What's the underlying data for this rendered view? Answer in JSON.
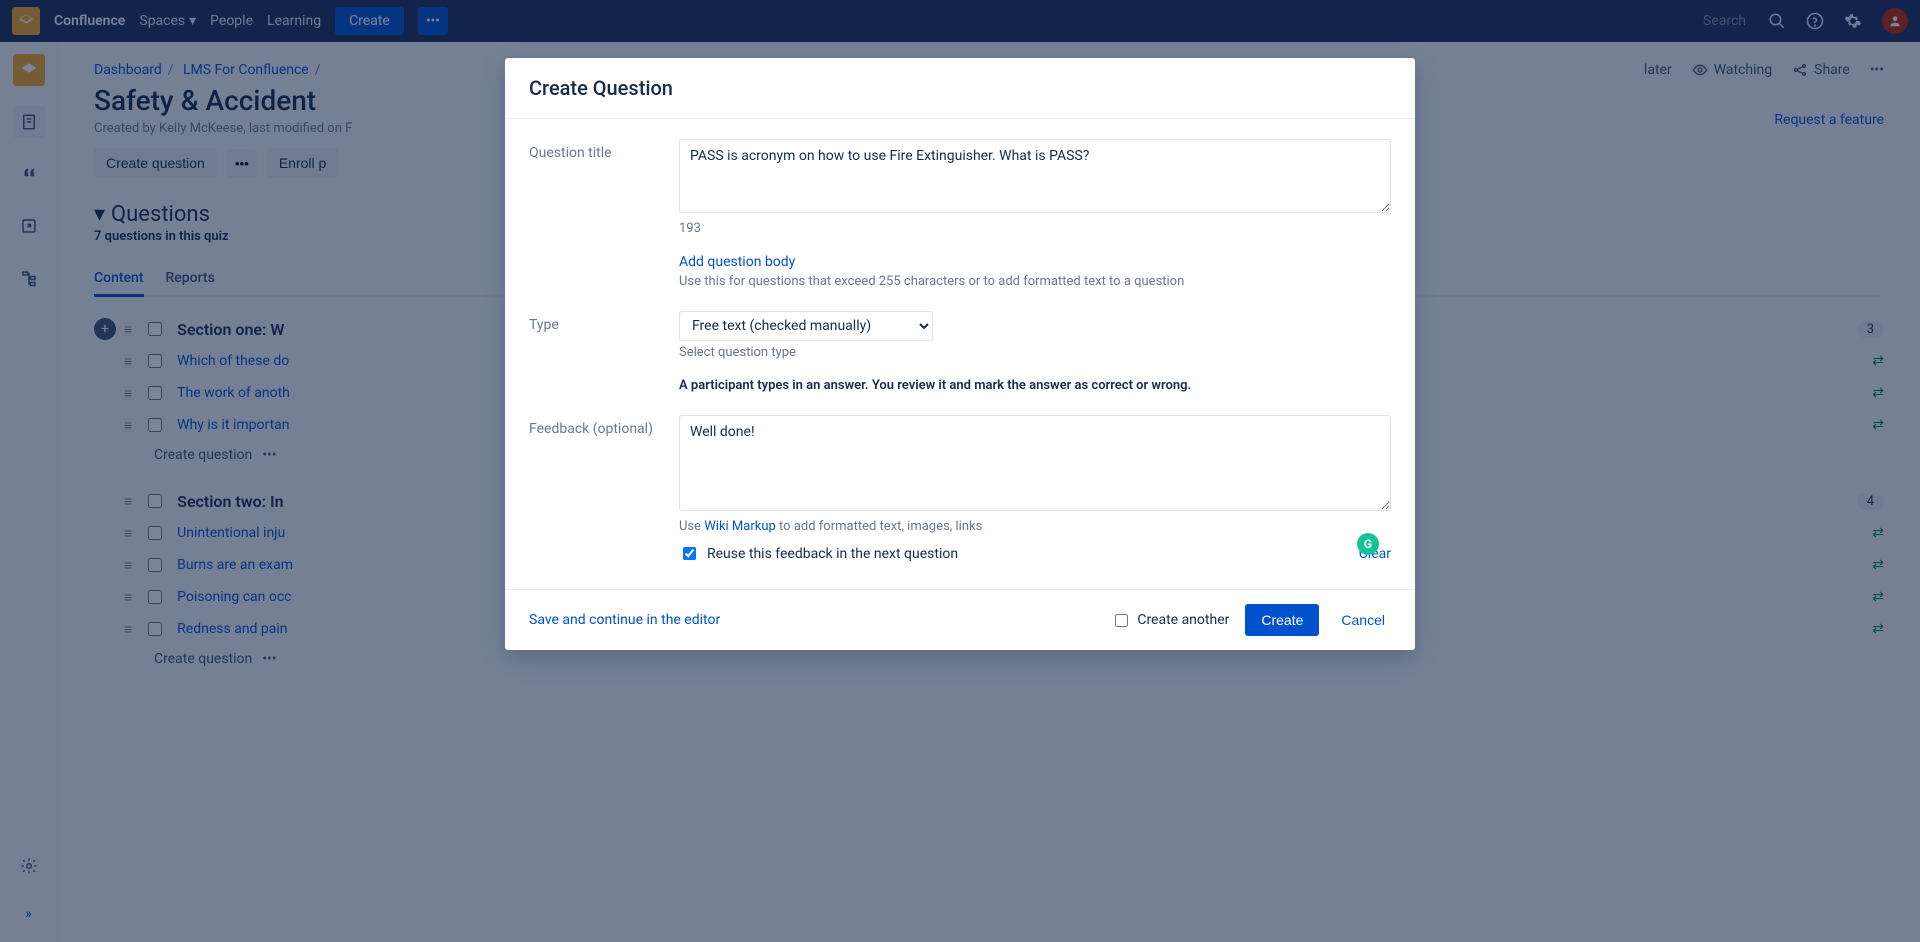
{
  "topbar": {
    "brand": "Confluence",
    "nav": {
      "spaces": "Spaces",
      "people": "People",
      "learning": "Learning"
    },
    "create": "Create",
    "search_placeholder": "Search"
  },
  "right_actions": {
    "later": "later",
    "watching": "Watching",
    "share": "Share"
  },
  "crumbs": {
    "dashboard": "Dashboard",
    "lms": "LMS For Confluence"
  },
  "page": {
    "title": "Safety & Accident",
    "subtitle": "Created by Kelly McKeese, last modified on F",
    "create_question": "Create question",
    "enroll": "Enroll p",
    "request_feature": "Request a feature",
    "questions_heading": "Questions",
    "questions_sub": "7 questions in this quiz"
  },
  "tabs": {
    "content": "Content",
    "reports": "Reports"
  },
  "questions": {
    "section1": "Section one: W",
    "q1": "Which of these do",
    "q2": "The work of anoth",
    "q3": "Why is it importan",
    "section2": "Section two: In",
    "q4": "Unintentional inju",
    "q5": "Burns are an exam",
    "q6": "Poisoning can occ",
    "q7": "Redness and pain",
    "create": "Create question",
    "badge1": "3",
    "badge2": "4"
  },
  "modal": {
    "title": "Create Question",
    "labels": {
      "question_title": "Question title",
      "type": "Type",
      "feedback": "Feedback (optional)"
    },
    "question_value": "PASS is acronym on how to use Fire Extinguisher. What is PASS?",
    "char_count": "193",
    "add_body": "Add question body",
    "add_body_hint": "Use this for questions that exceed 255 characters or to add formatted text to a question",
    "type_value": "Free text (checked manually)",
    "type_hint": "Select question type",
    "type_desc": "A participant types in an answer. You review it and mark the answer as correct or wrong.",
    "feedback_value": "Well done!",
    "wiki_use": "Use ",
    "wiki_markup": "Wiki Markup",
    "wiki_rest": " to add formatted text, images, links",
    "reuse": "Reuse this feedback in the next question",
    "clear": "Clear",
    "footer": {
      "save_continue": "Save and continue in the editor",
      "create_another": "Create another",
      "create": "Create",
      "cancel": "Cancel"
    }
  }
}
